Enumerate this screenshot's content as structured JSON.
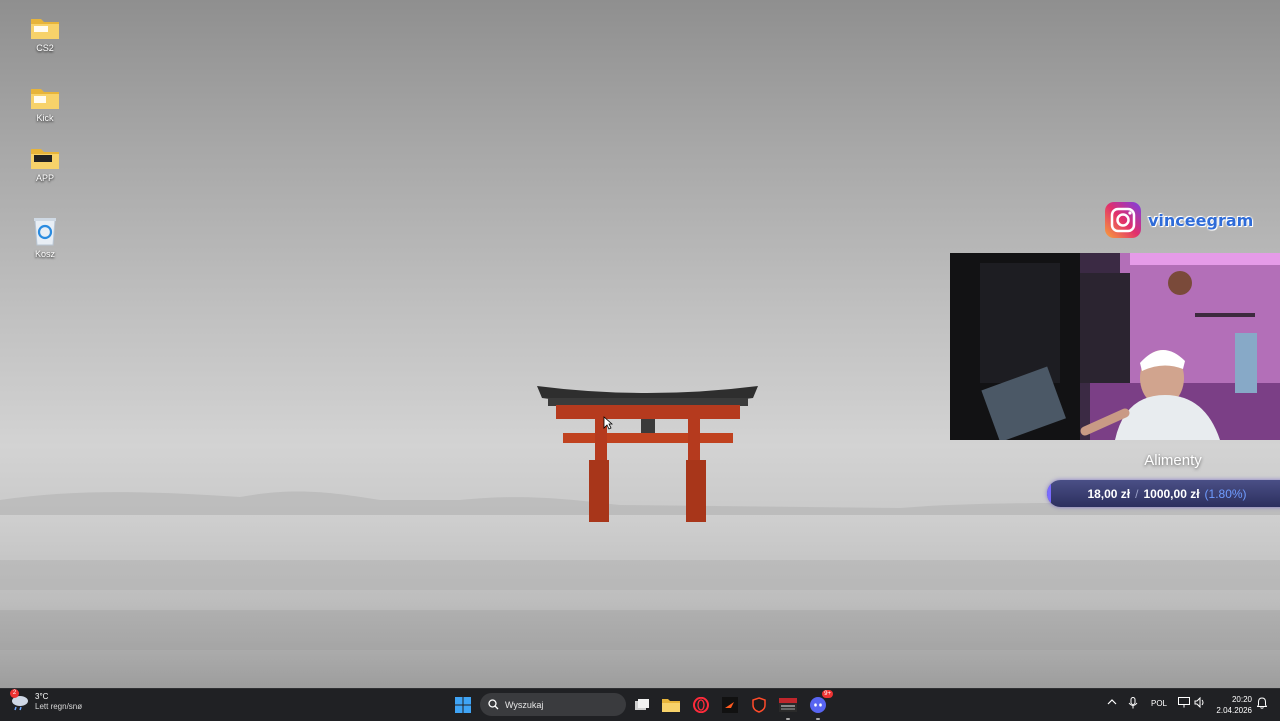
{
  "desktop": {
    "icons": [
      {
        "label": "CS2",
        "icon": "folder-icon"
      },
      {
        "label": "Kick",
        "icon": "folder-icon"
      },
      {
        "label": "APP",
        "icon": "folder-icon"
      },
      {
        "label": "Kosz",
        "icon": "recycle-bin-icon"
      }
    ]
  },
  "stream_overlay": {
    "instagram_handle": "vinceegram",
    "goal": {
      "title": "Alimenty",
      "current": "18,00 zł",
      "separator": "/",
      "target": "1000,00 zł",
      "percent_text": "(1.80%)",
      "progress_fraction": 0.018
    }
  },
  "taskbar": {
    "weather": {
      "temperature": "3°C",
      "condition": "Lett regn/snø",
      "badge": "2"
    },
    "search_placeholder": "Wyszukaj",
    "apps": [
      {
        "name": "task-view",
        "icon": "task-view-icon"
      },
      {
        "name": "file-explorer",
        "icon": "folder-icon"
      },
      {
        "name": "opera-gx",
        "icon": "opera-icon"
      },
      {
        "name": "app-dark",
        "icon": "app-icon"
      },
      {
        "name": "faceit",
        "icon": "shield-icon"
      },
      {
        "name": "voicemeeter",
        "icon": "voicemeeter-icon"
      },
      {
        "name": "discord",
        "icon": "discord-icon",
        "badge": "9+"
      }
    ],
    "tray": {
      "language": "POL",
      "time": "20:20",
      "date": "2.04.2026"
    }
  },
  "colors": {
    "taskbar": "#202124",
    "torii": "#b53a1e",
    "goal_bar": "#2c2f5e",
    "instagram_text": "#2e6bd8"
  }
}
